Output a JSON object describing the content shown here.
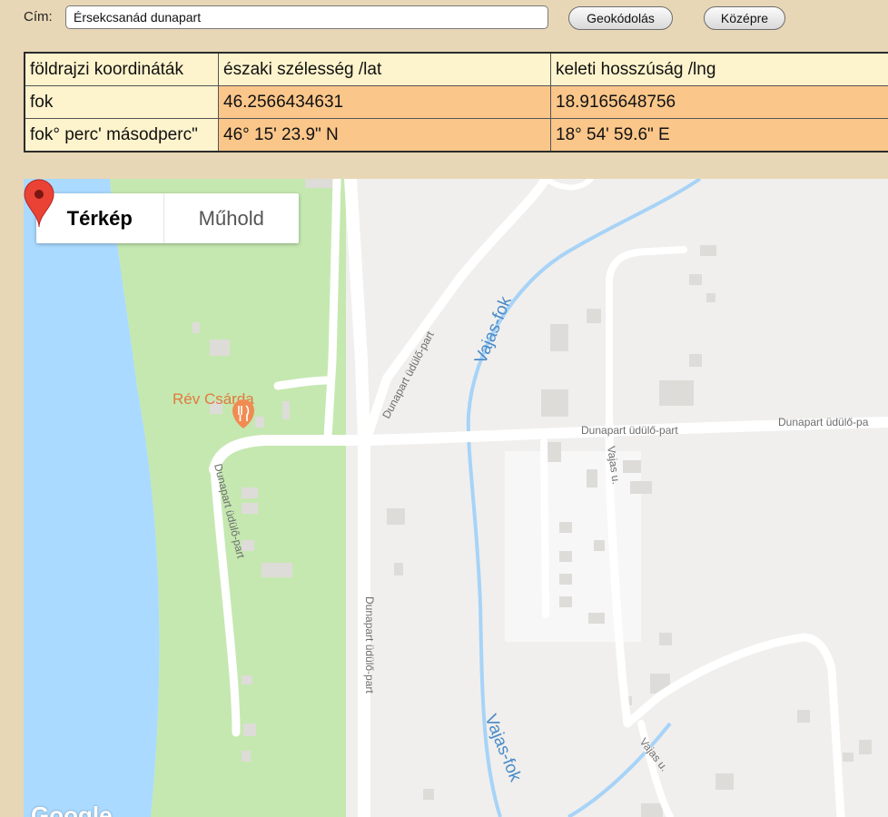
{
  "form": {
    "address_label": "Cím:",
    "address_value": "Érsekcsanád dunapart",
    "geocode_button": "Geokódolás",
    "center_button": "Középre"
  },
  "table": {
    "headers": [
      "földrajzi koordináták",
      "északi szélesség /lat",
      "keleti hosszúság /lng"
    ],
    "rows": [
      [
        "fok",
        "46.2566434631",
        "18.9165648756"
      ],
      [
        "fok° perc' másodperc\"",
        "46° 15' 23.9\" N",
        "18° 54' 59.6\" E"
      ]
    ]
  },
  "map": {
    "type_map": "Térkép",
    "type_satellite": "Műhold",
    "poi_name": "Rév Csárda",
    "labels": {
      "road_diag": "Dunapart üdülő-part",
      "vajas_fok_top": "Vajas-fok",
      "road_main1": "Dunapart üdülő-part",
      "road_main2": "Dunapart üdülő-pa",
      "vajas_u_1": "Vajas u.",
      "road_left": "Dunapart üdülő-part",
      "road_vertical": "Dunapart üdülő-part",
      "vajas_fok_bottom": "Vajas-fok",
      "vajas_u_2": "Vajas u."
    },
    "logo": "Google",
    "colors": {
      "water": "#aadaff",
      "park": "#c5e8b0",
      "land": "#f0efed",
      "road": "#ffffff",
      "marker": "#ea4335",
      "poi": "#f08c52",
      "stream": "#a7d3f7"
    }
  }
}
